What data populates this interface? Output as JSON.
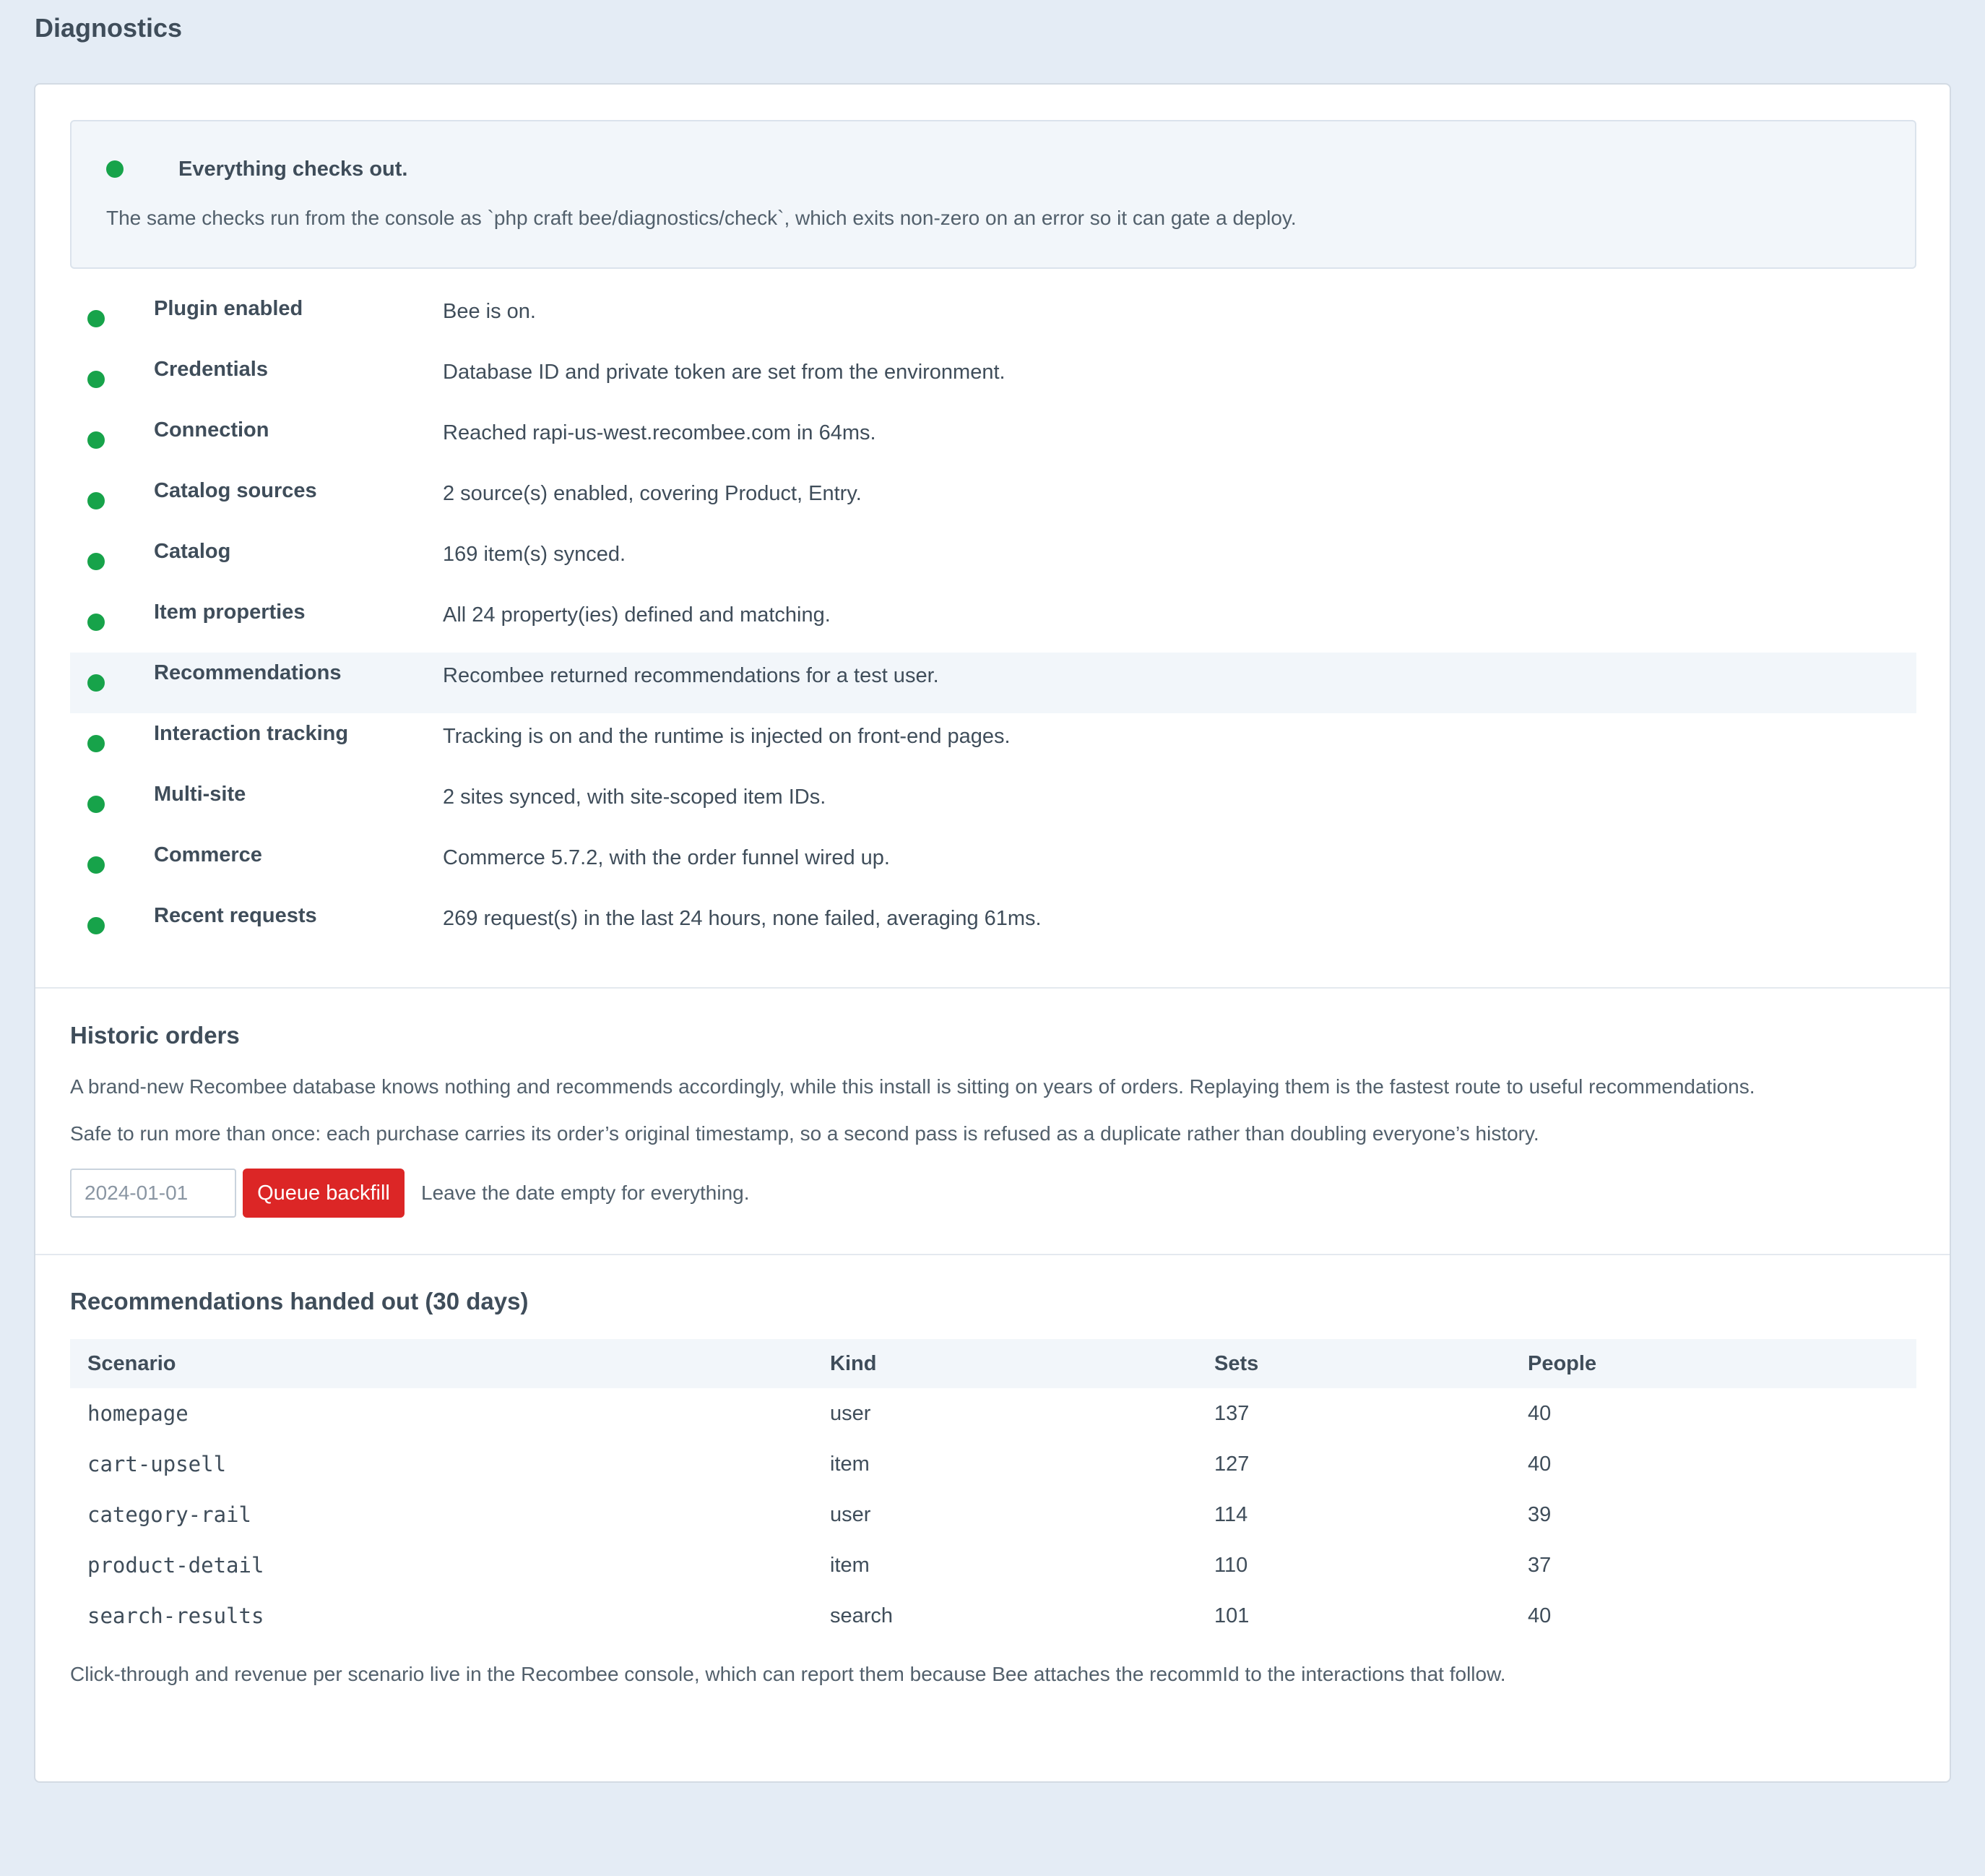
{
  "page": {
    "title": "Diagnostics"
  },
  "colors": {
    "ok": "#17a34a",
    "danger": "#dc2626"
  },
  "summary": {
    "status": "ok",
    "title": "Everything checks out.",
    "text": "The same checks run from the console as `php craft bee/diagnostics/check`, which exits non-zero on an error so it can gate a deploy."
  },
  "checks": [
    {
      "status": "ok",
      "name": "Plugin enabled",
      "detail": "Bee is on."
    },
    {
      "status": "ok",
      "name": "Credentials",
      "detail": "Database ID and private token are set from the environment."
    },
    {
      "status": "ok",
      "name": "Connection",
      "detail": "Reached rapi-us-west.recombee.com in 64ms."
    },
    {
      "status": "ok",
      "name": "Catalog sources",
      "detail": "2 source(s) enabled, covering Product, Entry."
    },
    {
      "status": "ok",
      "name": "Catalog",
      "detail": "169 item(s) synced."
    },
    {
      "status": "ok",
      "name": "Item properties",
      "detail": "All 24 property(ies) defined and matching."
    },
    {
      "status": "ok",
      "name": "Recommendations",
      "detail": "Recombee returned recommendations for a test user."
    },
    {
      "status": "ok",
      "name": "Interaction tracking",
      "detail": "Tracking is on and the runtime is injected on front-end pages."
    },
    {
      "status": "ok",
      "name": "Multi-site",
      "detail": "2 sites synced, with site-scoped item IDs."
    },
    {
      "status": "ok",
      "name": "Commerce",
      "detail": "Commerce 5.7.2, with the order funnel wired up."
    },
    {
      "status": "ok",
      "name": "Recent requests",
      "detail": "269 request(s) in the last 24 hours, none failed, averaging 61ms."
    }
  ],
  "historic": {
    "title": "Historic orders",
    "para1": "A brand-new Recombee database knows nothing and recommends accordingly, while this install is sitting on years of orders. Replaying them is the fastest route to useful recommendations.",
    "para2": "Safe to run more than once: each purchase carries its order’s original timestamp, so a second pass is refused as a duplicate rather than doubling everyone’s history.",
    "date_placeholder": "2024-01-01",
    "date_value": "",
    "button_label": "Queue backfill",
    "hint": "Leave the date empty for everything."
  },
  "stats": {
    "title": "Recommendations handed out (30 days)",
    "columns": [
      "Scenario",
      "Kind",
      "Sets",
      "People"
    ],
    "rows": [
      [
        "homepage",
        "user",
        "137",
        "40"
      ],
      [
        "cart-upsell",
        "item",
        "127",
        "40"
      ],
      [
        "category-rail",
        "user",
        "114",
        "39"
      ],
      [
        "product-detail",
        "item",
        "110",
        "37"
      ],
      [
        "search-results",
        "search",
        "101",
        "40"
      ]
    ],
    "footnote": "Click-through and revenue per scenario live in the Recombee console, which can report them because Bee attaches the recommId to the interactions that follow."
  }
}
